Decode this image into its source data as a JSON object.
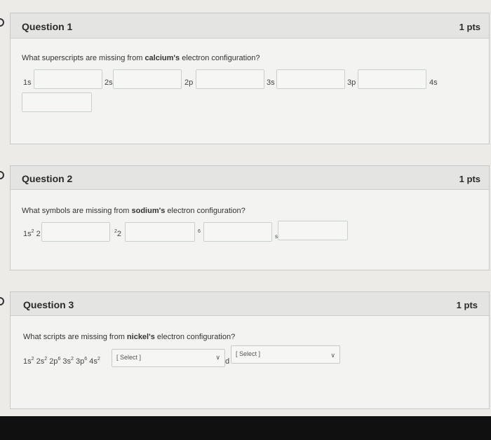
{
  "q1": {
    "title": "Question 1",
    "points": "1 pts",
    "prompt_pre": "What superscripts are missing from ",
    "prompt_bold": "calcium's",
    "prompt_post": " electron configuration?",
    "labels": [
      "1s",
      "2s",
      "2p",
      "3s",
      "3p",
      "4s"
    ]
  },
  "q2": {
    "title": "Question 2",
    "points": "1 pts",
    "prompt_pre": "What symbols are missing from ",
    "prompt_bold": "sodium's",
    "prompt_post": " electron configuration?",
    "seg1_base": "1s",
    "seg1_sup": "2",
    "seg1_after": " 2",
    "seg2_sup": "2",
    "seg2_after": "2",
    "seg3_sup": "6",
    "seg4_sub": "s"
  },
  "q3": {
    "title": "Question 3",
    "points": "1 pts",
    "prompt_pre": "What scripts are missing from ",
    "prompt_bold": "nickel's",
    "prompt_post": " electron configuration?",
    "config": [
      "1s",
      "2",
      "2s",
      "2",
      "2p",
      "6",
      "3s",
      "2",
      "3p",
      "6",
      "4s",
      "2"
    ],
    "d_label": "d",
    "select1": "[ Select ]",
    "select2": "[ Select ]"
  }
}
